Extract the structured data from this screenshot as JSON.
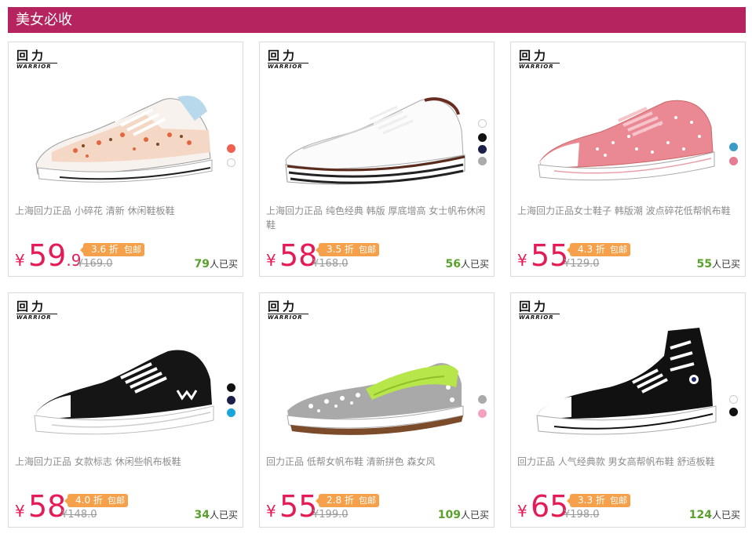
{
  "section_title": "美女必收",
  "currency": "¥",
  "products": [
    {
      "brand_cn": "回力",
      "brand_en": "WARRIOR",
      "title": "上海回力正品 小碎花 清新 休闲鞋板鞋",
      "price": "59",
      "price_decimal": ".9",
      "discount": "3.6 折",
      "shipping": "包邮",
      "original_price": "¥169.0",
      "sold_count": "79",
      "sold_suffix": "人已买",
      "swatches": [
        "#f06050",
        "#ffffff"
      ]
    },
    {
      "brand_cn": "回力",
      "brand_en": "WARRIOR",
      "title": "上海回力正品 纯色经典 韩版 厚底增高 女士帆布休闲鞋",
      "price": "58",
      "price_decimal": "",
      "discount": "3.5 折",
      "shipping": "包邮",
      "original_price": "¥168.0",
      "sold_count": "56",
      "sold_suffix": "人已买",
      "swatches": [
        "#ffffff",
        "#111111",
        "#1a1f4a",
        "#aaaaaa"
      ]
    },
    {
      "brand_cn": "回力",
      "brand_en": "WARRIOR",
      "title": "上海回力正品女士鞋子 韩版潮 波点碎花低帮帆布鞋",
      "price": "55",
      "price_decimal": "",
      "discount": "4.3 折",
      "shipping": "包邮",
      "original_price": "¥129.0",
      "sold_count": "55",
      "sold_suffix": "人已买",
      "swatches": [
        "#3a9bc4",
        "#e57c91"
      ]
    },
    {
      "brand_cn": "回力",
      "brand_en": "WARRIOR",
      "title": "上海回力正品 女款标志 休闲些帆布板鞋",
      "price": "58",
      "price_decimal": "",
      "discount": "4.0 折",
      "shipping": "包邮",
      "original_price": "¥148.0",
      "sold_count": "34",
      "sold_suffix": "人已买",
      "swatches": [
        "#111111",
        "#1a1f4a",
        "#1aa6dc"
      ]
    },
    {
      "brand_cn": "回力",
      "brand_en": "WARRIOR",
      "title": "回力正品 低帮女帆布鞋 清新拼色 森女风",
      "price": "55",
      "price_decimal": "",
      "discount": "2.8 折",
      "shipping": "包邮",
      "original_price": "¥199.0",
      "sold_count": "109",
      "sold_suffix": "人已买",
      "swatches": [
        "#aaaaaa",
        "#f4a0c0"
      ]
    },
    {
      "brand_cn": "回力",
      "brand_en": "WARRIOR",
      "title": "回力正品 人气经典款 男女高帮帆布鞋 舒适板鞋",
      "price": "65",
      "price_decimal": "",
      "discount": "3.3 折",
      "shipping": "包邮",
      "original_price": "¥198.0",
      "sold_count": "124",
      "sold_suffix": "人已买",
      "swatches": [
        "#ffffff",
        "#111111"
      ]
    }
  ]
}
